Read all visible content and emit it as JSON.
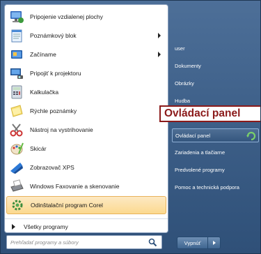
{
  "programs": [
    {
      "label": "Pripojenie vzdialenej plochy",
      "icon": "remote-desktop-icon",
      "has_submenu": false
    },
    {
      "label": "Poznámkový blok",
      "icon": "notepad-icon",
      "has_submenu": true
    },
    {
      "label": "Začíname",
      "icon": "getting-started-icon",
      "has_submenu": true
    },
    {
      "label": "Pripojiť k projektoru",
      "icon": "projector-icon",
      "has_submenu": false
    },
    {
      "label": "Kalkulačka",
      "icon": "calculator-icon",
      "has_submenu": false
    },
    {
      "label": "Rýchle poznámky",
      "icon": "sticky-notes-icon",
      "has_submenu": false
    },
    {
      "label": "Nástroj na vystrihovanie",
      "icon": "snipping-tool-icon",
      "has_submenu": false
    },
    {
      "label": "Skicár",
      "icon": "paint-icon",
      "has_submenu": false
    },
    {
      "label": "Zobrazovač XPS",
      "icon": "xps-viewer-icon",
      "has_submenu": false
    },
    {
      "label": "Windows Faxovanie a skenovanie",
      "icon": "fax-scan-icon",
      "has_submenu": false
    },
    {
      "label": "Odinštalační program Corel",
      "icon": "uninstall-icon",
      "has_submenu": false,
      "highlighted": true
    }
  ],
  "all_programs_label": "Všetky programy",
  "search": {
    "placeholder": "Prehľadať programy a súbory"
  },
  "right_items": {
    "user": "user",
    "documents": "Dokumenty",
    "pictures": "Obrázky",
    "music": "Hudba",
    "control_panel": "Ovládací panel",
    "devices": "Zariadenia a tlačiarne",
    "default_programs": "Predvolené programy",
    "help": "Pomoc a technická podpora"
  },
  "tooltip": "Ovládací panel",
  "shutdown_label": "Vypnúť",
  "colors": {
    "highlight": "#fbd98f",
    "tooltip_border": "#8b1a1a",
    "menu_blue": "#3e6089"
  }
}
